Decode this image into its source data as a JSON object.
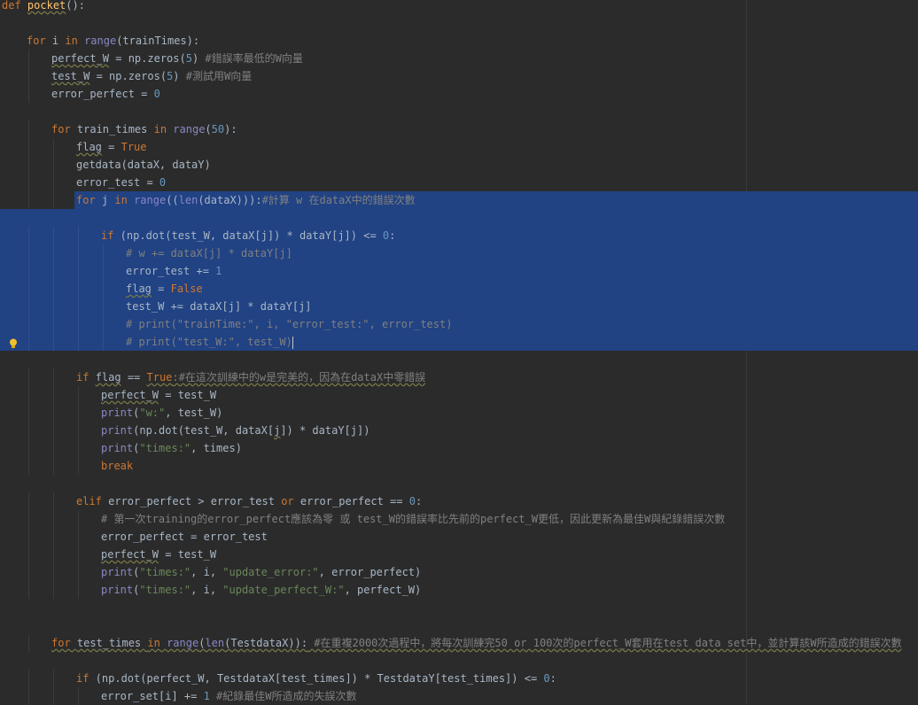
{
  "editor": {
    "lines": [
      {
        "indent": 0,
        "selected": false,
        "tokens": [
          [
            "kw",
            "def"
          ],
          [
            "",
            " "
          ],
          [
            "fn",
            "pocket"
          ],
          [
            "",
            "():"
          ]
        ]
      },
      {
        "indent": 0,
        "selected": false,
        "tokens": []
      },
      {
        "indent": 1,
        "selected": false,
        "tokens": [
          [
            "kw",
            "for"
          ],
          [
            "",
            " i "
          ],
          [
            "kw",
            "in"
          ],
          [
            "",
            " "
          ],
          [
            "bi",
            "range"
          ],
          [
            "",
            "(trainTimes):"
          ]
        ]
      },
      {
        "indent": 2,
        "selected": false,
        "tokens": [
          [
            "wv",
            "perfect_W"
          ],
          [
            "",
            " = np.zeros("
          ],
          [
            "num",
            "5"
          ],
          [
            "",
            ")"
          ],
          [
            "cm",
            " #錯誤率最低的W向量"
          ]
        ]
      },
      {
        "indent": 2,
        "selected": false,
        "tokens": [
          [
            "wv",
            "test_W"
          ],
          [
            "",
            " = np.zeros("
          ],
          [
            "num",
            "5"
          ],
          [
            "",
            ")"
          ],
          [
            "cm",
            " #測試用W向量"
          ]
        ]
      },
      {
        "indent": 2,
        "selected": false,
        "tokens": [
          [
            "",
            "error_perfect = "
          ],
          [
            "num",
            "0"
          ]
        ]
      },
      {
        "indent": 0,
        "selected": false,
        "tokens": []
      },
      {
        "indent": 2,
        "selected": false,
        "tokens": [
          [
            "kw",
            "for"
          ],
          [
            "",
            " train_times "
          ],
          [
            "kw",
            "in"
          ],
          [
            "",
            " "
          ],
          [
            "bi",
            "range"
          ],
          [
            "",
            "("
          ],
          [
            "num",
            "50"
          ],
          [
            "",
            "):"
          ]
        ]
      },
      {
        "indent": 3,
        "selected": false,
        "tokens": [
          [
            "wv",
            "flag"
          ],
          [
            "",
            " = "
          ],
          [
            "kw",
            "True"
          ]
        ]
      },
      {
        "indent": 3,
        "selected": false,
        "tokens": [
          [
            "",
            "getdata(dataX, dataY)"
          ]
        ]
      },
      {
        "indent": 3,
        "selected": false,
        "tokens": [
          [
            "",
            "error_test = "
          ],
          [
            "num",
            "0"
          ]
        ]
      },
      {
        "indent": 3,
        "selected": "partial",
        "tokens": [
          [
            "kw",
            "for"
          ],
          [
            "",
            " j "
          ],
          [
            "kw",
            "in"
          ],
          [
            "",
            " "
          ],
          [
            "bi",
            "range"
          ],
          [
            "",
            "(("
          ],
          [
            "bi",
            "len"
          ],
          [
            "",
            "(dataX))):"
          ],
          [
            "cm",
            "#計算 w 在dataX中的錯誤次數"
          ]
        ]
      },
      {
        "indent": 0,
        "selected": true,
        "tokens": []
      },
      {
        "indent": 4,
        "selected": true,
        "tokens": [
          [
            "kw",
            "if"
          ],
          [
            "",
            " (np.dot(test_W, dataX[j]) * dataY[j]) <= "
          ],
          [
            "num",
            "0"
          ],
          [
            "",
            ":"
          ]
        ]
      },
      {
        "indent": 5,
        "selected": true,
        "tokens": [
          [
            "cm",
            "# w += dataX[j] * dataY[j]"
          ]
        ]
      },
      {
        "indent": 5,
        "selected": true,
        "tokens": [
          [
            "",
            "error_test += "
          ],
          [
            "num",
            "1"
          ]
        ]
      },
      {
        "indent": 5,
        "selected": true,
        "tokens": [
          [
            "wv",
            "flag"
          ],
          [
            "",
            " = "
          ],
          [
            "kw",
            "False"
          ]
        ]
      },
      {
        "indent": 5,
        "selected": true,
        "tokens": [
          [
            "",
            "test_W += dataX[j] * dataY[j]"
          ]
        ]
      },
      {
        "indent": 5,
        "selected": true,
        "tokens": [
          [
            "cm",
            "# print(\"trainTime:\", i, \"error_test:\", error_test)"
          ]
        ]
      },
      {
        "indent": 5,
        "selected": true,
        "caret": true,
        "bulb": true,
        "tokens": [
          [
            "cm",
            "# print(\"test_W:\", test_W)"
          ]
        ]
      },
      {
        "indent": 0,
        "selected": false,
        "tokens": []
      },
      {
        "indent": 3,
        "selected": false,
        "tokens": [
          [
            "kw",
            "if"
          ],
          [
            "",
            " "
          ],
          [
            "wv",
            "flag"
          ],
          [
            "",
            " == "
          ],
          [
            "kwwv",
            "True"
          ],
          [
            "cmwv",
            ":#在這次訓練中的w是完美的，因為在dataX中零錯誤"
          ]
        ]
      },
      {
        "indent": 4,
        "selected": false,
        "tokens": [
          [
            "wv",
            "perfect_W"
          ],
          [
            "",
            " = test_W"
          ]
        ]
      },
      {
        "indent": 4,
        "selected": false,
        "tokens": [
          [
            "bi",
            "print"
          ],
          [
            "",
            "("
          ],
          [
            "str",
            "\"w:\""
          ],
          [
            "",
            ", test_W)"
          ]
        ]
      },
      {
        "indent": 4,
        "selected": false,
        "tokens": [
          [
            "bi",
            "print"
          ],
          [
            "",
            "(np.dot(test_W, dataX["
          ],
          [
            "wv",
            "j"
          ],
          [
            "",
            "]) * dataY[j])"
          ]
        ]
      },
      {
        "indent": 4,
        "selected": false,
        "tokens": [
          [
            "bi",
            "print"
          ],
          [
            "",
            "("
          ],
          [
            "str",
            "\"times:\""
          ],
          [
            "",
            ", times)"
          ]
        ]
      },
      {
        "indent": 4,
        "selected": false,
        "tokens": [
          [
            "kw",
            "break"
          ]
        ]
      },
      {
        "indent": 0,
        "selected": false,
        "tokens": []
      },
      {
        "indent": 3,
        "selected": false,
        "tokens": [
          [
            "kw",
            "elif"
          ],
          [
            "",
            " error_perfect > error_test "
          ],
          [
            "kw",
            "or"
          ],
          [
            "",
            " error_perfect == "
          ],
          [
            "num",
            "0"
          ],
          [
            "",
            ":"
          ]
        ]
      },
      {
        "indent": 4,
        "selected": false,
        "tokens": [
          [
            "cm",
            "# 第一次training的error_perfect應該為零 或 test_W的錯誤率比先前的perfect_W更低，因此更新為最佳W與紀錄錯誤次數"
          ]
        ]
      },
      {
        "indent": 4,
        "selected": false,
        "tokens": [
          [
            "",
            "error_perfect = error_test"
          ]
        ]
      },
      {
        "indent": 4,
        "selected": false,
        "tokens": [
          [
            "wv",
            "perfect_W"
          ],
          [
            "",
            " = test_W"
          ]
        ]
      },
      {
        "indent": 4,
        "selected": false,
        "tokens": [
          [
            "bi",
            "print"
          ],
          [
            "",
            "("
          ],
          [
            "str",
            "\"times:\""
          ],
          [
            "",
            ", i, "
          ],
          [
            "str",
            "\"update_error:\""
          ],
          [
            "",
            ", error_perfect)"
          ]
        ]
      },
      {
        "indent": 4,
        "selected": false,
        "tokens": [
          [
            "bi",
            "print"
          ],
          [
            "",
            "("
          ],
          [
            "str",
            "\"times:\""
          ],
          [
            "",
            ", i, "
          ],
          [
            "str",
            "\"update_perfect_W:\""
          ],
          [
            "",
            ", perfect_W)"
          ]
        ]
      },
      {
        "indent": 0,
        "selected": false,
        "tokens": []
      },
      {
        "indent": 0,
        "selected": false,
        "tokens": []
      },
      {
        "indent": 2,
        "selected": false,
        "tokens": [
          [
            "kwwv",
            "for"
          ],
          [
            "wv",
            " test_times "
          ],
          [
            "kwwv",
            "in"
          ],
          [
            "wv",
            " "
          ],
          [
            "biwv",
            "range"
          ],
          [
            "wv",
            "("
          ],
          [
            "biwv",
            "len"
          ],
          [
            "wv",
            "(TestdataX)):"
          ],
          [
            "cmwv",
            " #在重複2000次過程中，將每次訓練完50 or 100次的perfect_W套用在test data set中，並計算該W所造成的錯誤次數"
          ]
        ]
      },
      {
        "indent": 0,
        "selected": false,
        "tokens": []
      },
      {
        "indent": 3,
        "selected": false,
        "tokens": [
          [
            "kw",
            "if"
          ],
          [
            "",
            " (np.dot(perfect_W, TestdataX[test_times]) * TestdataY[test_times]) <= "
          ],
          [
            "num",
            "0"
          ],
          [
            "",
            ":"
          ]
        ]
      },
      {
        "indent": 4,
        "selected": false,
        "tokens": [
          [
            "",
            "error_set[i] += "
          ],
          [
            "num",
            "1"
          ],
          [
            "cm",
            " #紀錄最佳W所造成的失誤次數"
          ]
        ]
      }
    ]
  }
}
